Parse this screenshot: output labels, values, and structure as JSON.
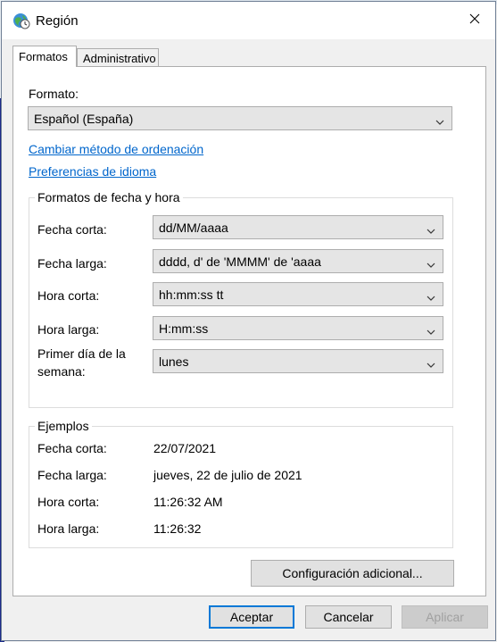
{
  "window": {
    "title": "Región"
  },
  "tabs": [
    {
      "label": "Formatos",
      "active": true
    },
    {
      "label": "Administrativo",
      "active": false
    }
  ],
  "format": {
    "label": "Formato:",
    "selected": "Español (España)"
  },
  "links": {
    "sort_method": "Cambiar método de ordenación",
    "language_prefs": "Preferencias de idioma"
  },
  "date_time_formats": {
    "title": "Formatos de fecha y hora",
    "rows": [
      {
        "label": "Fecha corta:",
        "value": "dd/MM/aaaa"
      },
      {
        "label": "Fecha larga:",
        "value": "dddd, d' de 'MMMM' de 'aaaa"
      },
      {
        "label": "Hora corta:",
        "value": "hh:mm:ss tt"
      },
      {
        "label": "Hora larga:",
        "value": "H:mm:ss"
      }
    ],
    "first_day": {
      "label_line1": "Primer día de la",
      "label_line2": "semana:",
      "value": "lunes"
    }
  },
  "examples": {
    "title": "Ejemplos",
    "rows": [
      {
        "label": "Fecha corta:",
        "value": "22/07/2021"
      },
      {
        "label": "Fecha larga:",
        "value": "jueves, 22 de julio de 2021"
      },
      {
        "label": "Hora corta:",
        "value": "11:26:32 AM"
      },
      {
        "label": "Hora larga:",
        "value": "11:26:32"
      }
    ]
  },
  "buttons": {
    "additional": "Configuración adicional...",
    "accept": "Aceptar",
    "cancel": "Cancelar",
    "apply": "Aplicar"
  },
  "icons": {
    "app": "globe-clock-icon",
    "close": "close-icon",
    "dropdown": "chevron-down-icon"
  },
  "colors": {
    "link": "#0066cc",
    "accent": "#0078d7"
  }
}
